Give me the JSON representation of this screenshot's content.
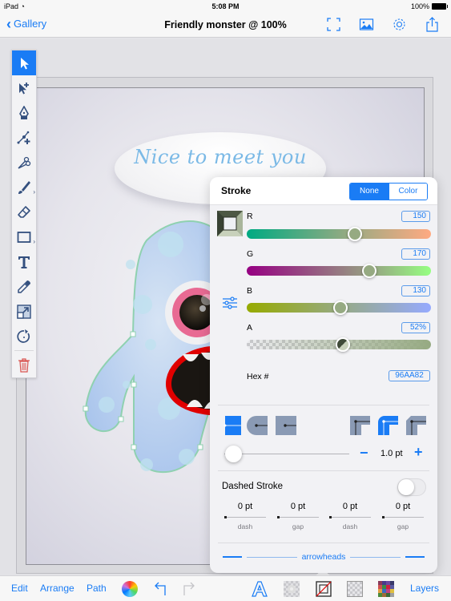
{
  "status_bar": {
    "device": "iPad",
    "wifi_icon": "wifi-icon",
    "time": "5:08 PM",
    "battery": "100%"
  },
  "nav": {
    "back_label": "Gallery",
    "title": "Friendly monster @ 100%",
    "icons": [
      "fullscreen-icon",
      "image-icon",
      "gear-icon",
      "share-icon"
    ]
  },
  "canvas": {
    "speech_bubble_text": "Nice to meet you"
  },
  "tools": [
    {
      "name": "select-tool",
      "icon": "arrow-pointer-icon",
      "active": true
    },
    {
      "name": "node-select-tool",
      "icon": "arrow-plus-icon"
    },
    {
      "name": "pen-tool",
      "icon": "pen-nib-icon"
    },
    {
      "name": "add-node-tool",
      "icon": "node-plus-icon"
    },
    {
      "name": "scissors-tool",
      "icon": "scissors-icon"
    },
    {
      "name": "brush-tool",
      "icon": "brush-icon",
      "submenu": true
    },
    {
      "name": "eraser-tool",
      "icon": "eraser-icon"
    },
    {
      "name": "shape-tool",
      "icon": "rectangle-icon",
      "submenu": true
    },
    {
      "name": "text-tool",
      "icon": "text-icon"
    },
    {
      "name": "eyedropper-tool",
      "icon": "eyedropper-icon"
    },
    {
      "name": "scale-tool",
      "icon": "resize-icon"
    },
    {
      "name": "rotate-tool",
      "icon": "rotate-icon"
    },
    {
      "name": "delete-tool",
      "icon": "trash-icon"
    }
  ],
  "stroke_panel": {
    "title": "Stroke",
    "mode_options": [
      "None",
      "Color"
    ],
    "mode_selected": "None",
    "channels": [
      {
        "label": "R",
        "value": "150",
        "fraction": 0.588
      },
      {
        "label": "G",
        "value": "170",
        "fraction": 0.667
      },
      {
        "label": "B",
        "value": "130",
        "fraction": 0.51
      },
      {
        "label": "A",
        "value": "52%",
        "fraction": 0.52
      }
    ],
    "hex_label": "Hex #",
    "hex_value": "96AA82",
    "stroke_color": "#96AA82",
    "width_value": "1.0 pt",
    "width_minus": "−",
    "width_plus": "+",
    "caps": [
      {
        "name": "butt-cap",
        "selected": true
      },
      {
        "name": "round-cap",
        "selected": false
      },
      {
        "name": "square-cap",
        "selected": false
      }
    ],
    "joins": [
      {
        "name": "miter-join",
        "selected": false
      },
      {
        "name": "round-join",
        "selected": true
      },
      {
        "name": "bevel-join",
        "selected": false
      }
    ],
    "dashed_label": "Dashed Stroke",
    "dashed_enabled": false,
    "dashes": [
      {
        "value": "0 pt",
        "label": "dash"
      },
      {
        "value": "0 pt",
        "label": "gap"
      },
      {
        "value": "0 pt",
        "label": "dash"
      },
      {
        "value": "0 pt",
        "label": "gap"
      }
    ],
    "arrowheads_label": "arrowheads"
  },
  "bottom_bar": {
    "edit": "Edit",
    "arrange": "Arrange",
    "path": "Path",
    "layers": "Layers",
    "icons": [
      "color-wheel-icon",
      "undo-icon",
      "redo-icon",
      "text-style-icon",
      "fill-icon",
      "stroke-icon",
      "opacity-icon",
      "swatches-icon"
    ]
  },
  "colors": {
    "accent": "#1A7CF5",
    "destructive": "#D9534F"
  }
}
